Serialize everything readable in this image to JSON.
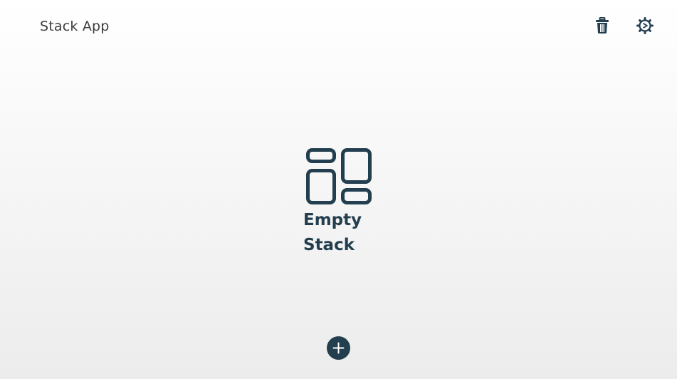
{
  "header": {
    "title": "Stack App",
    "actions": [
      {
        "icon": "trash-icon"
      },
      {
        "icon": "gear-icon"
      }
    ]
  },
  "empty_state": {
    "icon": "stack-layout-icon",
    "label": "Empty Stack"
  },
  "fab": {
    "icon": "plus-icon"
  },
  "colors": {
    "accent": "#223e4f",
    "title_text": "#3d3d3d",
    "background_top": "#ffffff",
    "background_bottom": "#ececec"
  }
}
